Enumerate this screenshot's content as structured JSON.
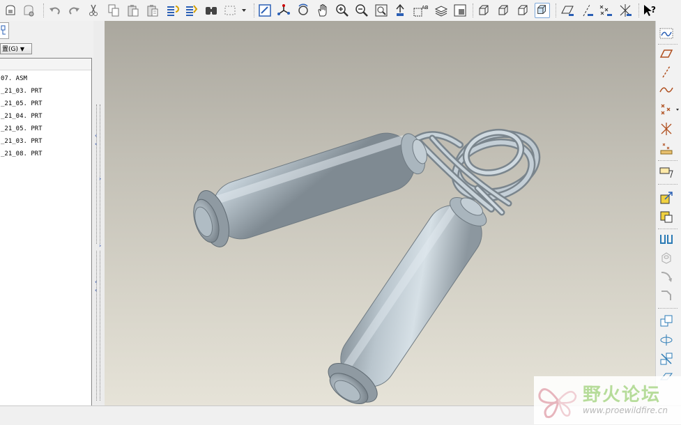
{
  "toolbar": {
    "groups": [
      [
        "open-file",
        "save"
      ],
      [
        "undo",
        "redo",
        "cut",
        "copy",
        "paste",
        "paste-special",
        "regenerate",
        "regenerate-manager",
        "find",
        "select-box"
      ],
      [
        "repaint",
        "spin-center",
        "orient-mode",
        "pan",
        "zoom-in",
        "zoom-out",
        "refit",
        "reorient",
        "view-manager",
        "layers",
        "appearance"
      ],
      [
        "wireframe",
        "hidden-line",
        "no-hidden",
        "shading"
      ],
      [
        "datum-planes",
        "datum-axes",
        "datum-points",
        "coord-systems"
      ],
      [
        "context-help"
      ]
    ],
    "active": "shading"
  },
  "left_panel": {
    "settings_label": "置(G)",
    "tree_items": [
      "07. ASM",
      "_21_03. PRT",
      "_21_05. PRT",
      "_21_04. PRT",
      "_21_05. PRT",
      "_21_03. PRT",
      "_21_08. PRT"
    ]
  },
  "right_toolbar": {
    "tools": [
      "sketch-tool",
      "plane-tool",
      "axis-tool",
      "curve-tool",
      "point-tool",
      "csys-tool",
      "analysis-tool",
      "note-tool",
      "place-component",
      "package-component",
      "mirror-tool",
      "hole-tool",
      "round-tool",
      "chamfer-tool",
      "copy-tool",
      "rotate-tool",
      "pattern-tool",
      "shell-tool"
    ]
  },
  "watermark": {
    "title": "野火论坛",
    "url": "www.proewildfire.cn"
  },
  "colors": {
    "model": "#b4c0c8",
    "background_top": "#aaa79e",
    "background_bottom": "#e6e3d8",
    "watermark_green": "#b6dc9a"
  }
}
